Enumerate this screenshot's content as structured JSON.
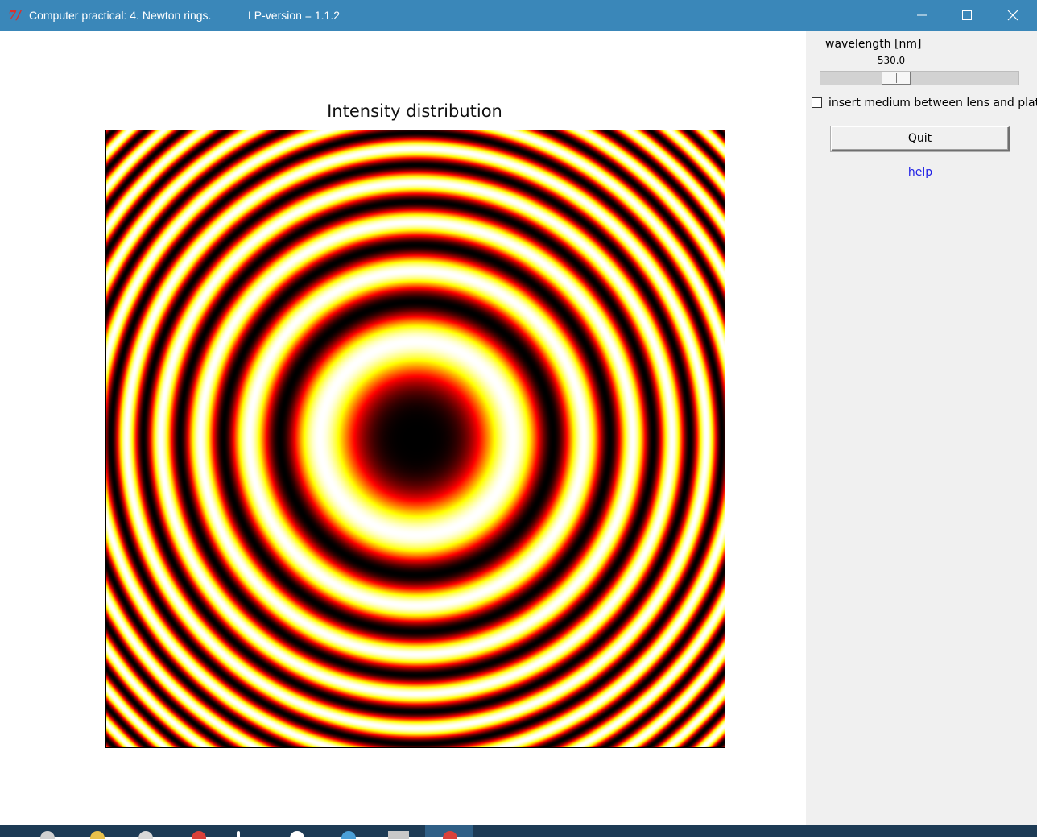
{
  "window": {
    "app_icon": "7⁄",
    "title": "Computer practical: 4. Newton rings.",
    "version": "LP-version = 1.1.2",
    "controls": [
      "minimize-icon",
      "maximize-icon",
      "close-icon"
    ]
  },
  "plot": {
    "title": "Intensity distribution",
    "colormap": "hot",
    "background": "#ffffff"
  },
  "panel": {
    "slider_label": "wavelength [nm]",
    "slider_value": "530.0",
    "slider_fraction": 0.36,
    "checkbox_label": "insert medium between lens and plate",
    "checkbox_checked": false,
    "quit_label": "Quit",
    "help_label": "help",
    "help_color": "#1f1fe6"
  },
  "colors": {
    "titlebar": "#3a87b9",
    "panel": "#f0f0f0",
    "taskbar": "#1d3b55"
  }
}
